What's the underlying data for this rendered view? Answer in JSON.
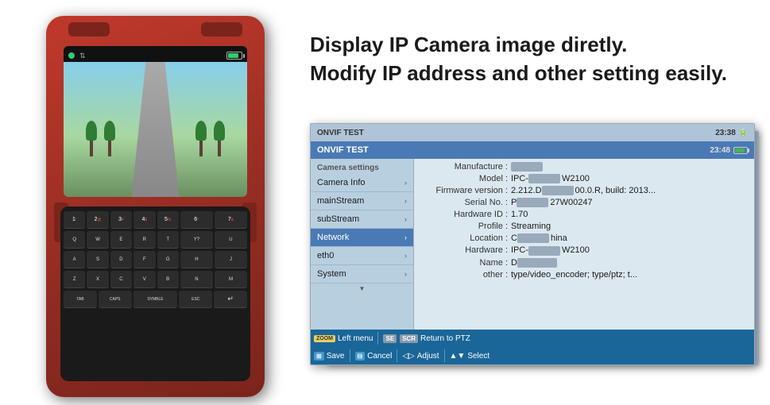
{
  "page": {
    "background": "#ffffff"
  },
  "headline": {
    "line1": "Display IP Camera image diretly.",
    "line2": "Modify IP address and other setting easily."
  },
  "device": {
    "screen_status": {
      "power_icon": "⏻",
      "arrows_icon": "⇅",
      "battery_label": "battery"
    },
    "camera": {
      "scene": "road-with-trees"
    },
    "keypad": {
      "rows": [
        [
          "1!",
          "2@",
          "3#",
          "4$",
          "5%",
          "6^~",
          "7&"
        ],
        [
          "Q~",
          "W",
          "E",
          "R[",
          "T]",
          "Y?",
          "U"
        ],
        [
          "A+",
          "S-",
          "D",
          "F<",
          "G>",
          "H",
          "J"
        ],
        [
          "Z/",
          "X=",
          "C",
          "V[",
          "B]",
          "N",
          "M"
        ],
        [
          "TAB",
          "CAPS",
          "SYMBLE",
          "ESC",
          "↵"
        ]
      ]
    }
  },
  "onvif_outer": {
    "title": "ONVIF TEST",
    "time": "23:38"
  },
  "onvif_inner": {
    "title": "ONVIF TEST",
    "time": "23:48",
    "sidebar": {
      "section_title": "Camera settings",
      "items": [
        {
          "label": "Camera Info",
          "has_arrow": true,
          "active": false
        },
        {
          "label": "mainStream",
          "has_arrow": true,
          "active": false
        },
        {
          "label": "subStream",
          "has_arrow": true,
          "active": false
        },
        {
          "label": "Network",
          "has_arrow": true,
          "active": true
        },
        {
          "label": "eth0",
          "has_arrow": true,
          "active": false
        },
        {
          "label": "System",
          "has_arrow": true,
          "active": false
        }
      ]
    },
    "info": {
      "rows": [
        {
          "label": "Manufacture :",
          "value": "D",
          "blurred": true,
          "value_after": ""
        },
        {
          "label": "Model :",
          "value": "IPC-",
          "blurred": true,
          "value_after": "W2100"
        },
        {
          "label": "Firmware version :",
          "value": "2.212.D",
          "blurred": false,
          "value_after": "00.0.R, build: 2013..."
        },
        {
          "label": "Serial No. :",
          "value": "P",
          "blurred": true,
          "value_after": "27W00247"
        },
        {
          "label": "Hardware ID :",
          "value": "1.70",
          "blurred": false,
          "value_after": ""
        },
        {
          "label": "Profile :",
          "value": "Streaming",
          "blurred": false,
          "value_after": ""
        },
        {
          "label": "Location :",
          "value": "C",
          "blurred": true,
          "value_after": "hina"
        },
        {
          "label": "Hardware :",
          "value": "IPC-",
          "blurred": true,
          "value_after": "W2100"
        },
        {
          "label": "Name :",
          "value": "D",
          "blurred": true,
          "value_after": ""
        },
        {
          "label": "other :",
          "value": "type/video_encoder; type/ptz; t...",
          "blurred": false,
          "value_after": ""
        }
      ]
    },
    "toolbar": {
      "row1": [
        {
          "icon": "ZOOM",
          "icon_style": "yellow",
          "label": "Left menu"
        },
        {
          "icon": "SE",
          "icon_style": "gray",
          "label": ""
        },
        {
          "icon": "SCR",
          "icon_style": "gray",
          "label": "Return to PTZ"
        }
      ],
      "row2": [
        {
          "icon": "⊞",
          "icon_style": "blue",
          "label": "Save"
        },
        {
          "icon": "⊟",
          "icon_style": "blue",
          "label": "Cancel"
        },
        {
          "icon": "◁▷",
          "icon_style": "text",
          "label": "Adjust"
        },
        {
          "icon": "▲▼",
          "icon_style": "text",
          "label": "Select"
        }
      ]
    }
  }
}
